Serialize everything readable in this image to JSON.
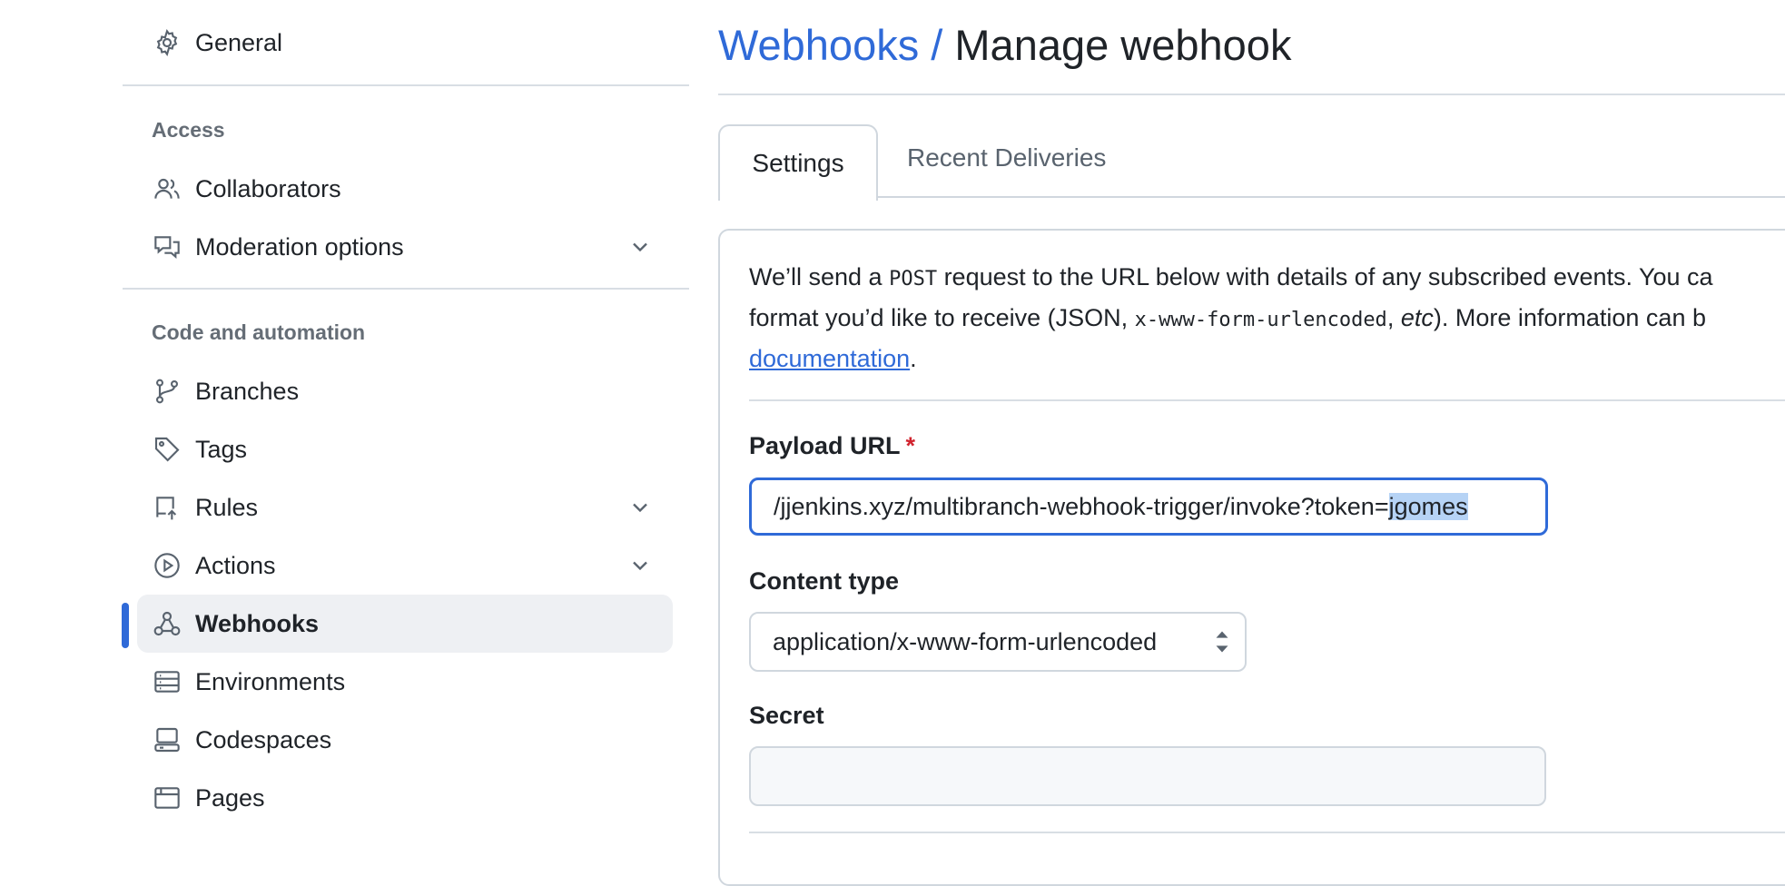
{
  "sidebar": {
    "general": "General",
    "access_title": "Access",
    "collaborators": "Collaborators",
    "moderation": "Moderation options",
    "code_title": "Code and automation",
    "branches": "Branches",
    "tags": "Tags",
    "rules": "Rules",
    "actions": "Actions",
    "webhooks": "Webhooks",
    "environments": "Environments",
    "codespaces": "Codespaces",
    "pages": "Pages"
  },
  "header": {
    "crumb": "Webhooks",
    "separator": "/",
    "title": "Manage webhook"
  },
  "tabs": {
    "settings": "Settings",
    "recent": "Recent Deliveries"
  },
  "description": {
    "part1": "We’ll send a ",
    "post": "POST",
    "part2": " request to the URL below with details of any subscribed events. You ca",
    "part3": "format you’d like to receive (JSON, ",
    "mono": "x-www-form-urlencoded",
    "part4": ", ",
    "etc": "etc",
    "part5": "). More information can b",
    "link": "documentation",
    "period": "."
  },
  "form": {
    "payload_label": "Payload URL",
    "required_mark": "*",
    "payload_value": "/jjenkins.xyz/multibranch-webhook-trigger/invoke?token=",
    "payload_selected": "jgomes",
    "content_type_label": "Content type",
    "content_type_value": "application/x-www-form-urlencoded",
    "secret_label": "Secret"
  },
  "colors": {
    "accent": "#2f6ad8",
    "required": "#d1242f",
    "selection": "#b6d3f5"
  }
}
